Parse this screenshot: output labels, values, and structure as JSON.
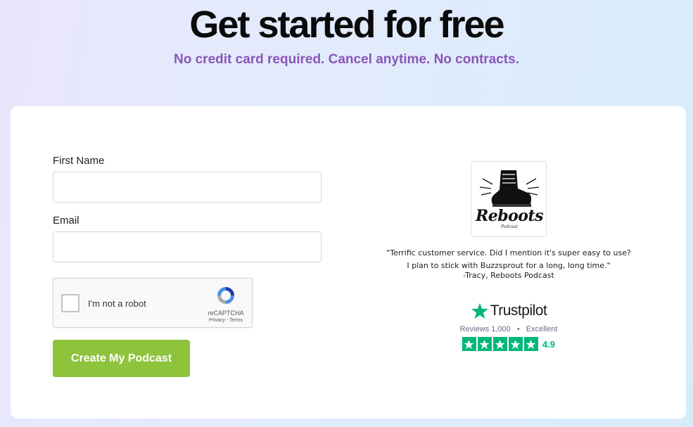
{
  "hero": {
    "title": "Get started for free",
    "subtitle": "No credit card required. Cancel anytime. No contracts."
  },
  "form": {
    "first_name_label": "First Name",
    "first_name_value": "",
    "email_label": "Email",
    "email_value": "",
    "captcha": {
      "label": "I'm not a robot",
      "brand": "reCAPTCHA",
      "links": "Privacy - Terms"
    },
    "submit_label": "Create My Podcast"
  },
  "testimonial": {
    "logo_text": "Reboots",
    "logo_sub": "Podcast",
    "quote": "\"Terrific customer service. Did I mention it's super easy to use? I plan to stick with Buzzsprout for a long, long time.\"",
    "author": "-Tracy, Reboots Podcast"
  },
  "trustpilot": {
    "brand": "Trustpilot",
    "reviews": "Reviews 1,000",
    "separator": "•",
    "rating_word": "Excellent",
    "score": "4.9",
    "stars": 5
  },
  "colors": {
    "accent_green": "#8ec43c",
    "subtitle_purple": "#8a56b8",
    "trustpilot_green": "#00b67a"
  }
}
